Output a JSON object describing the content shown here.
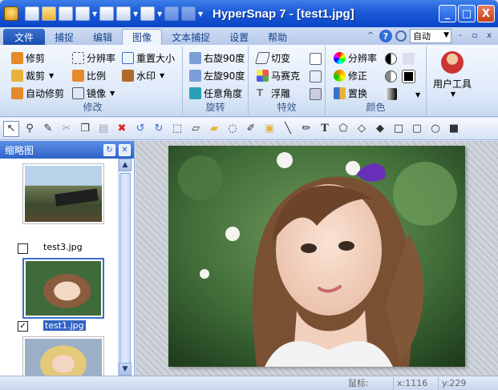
{
  "window": {
    "title": "HyperSnap 7 - [test1.jpg]",
    "controls": [
      "_",
      "□",
      "X"
    ]
  },
  "tabs": {
    "file": "文件",
    "items": [
      "捕捉",
      "编辑",
      "图像",
      "文本捕捉",
      "设置",
      "帮助"
    ],
    "active": "图像",
    "zoom_value": "自动",
    "help_glyph": "?",
    "caret_up": "^",
    "mini_controls": [
      "-",
      "▫",
      "x"
    ]
  },
  "ribbon": {
    "groups": [
      {
        "label": "修改",
        "items": [
          "修剪",
          "分辨率",
          "重置大小",
          "裁剪",
          "比例",
          "水印",
          "自动修剪",
          "镜像"
        ]
      },
      {
        "label": "旋转",
        "items": [
          "右旋90度",
          "左旋90度",
          "任意角度"
        ]
      },
      {
        "label": "特效",
        "items": [
          "切变",
          "马赛克",
          "浮雕"
        ]
      },
      {
        "label": "颜色",
        "items": [
          "分辨率",
          "修正",
          "置换"
        ]
      },
      {
        "label": "",
        "items": [
          "用户工具"
        ]
      }
    ]
  },
  "toolbar2": {
    "icons": [
      "select-arrow-icon",
      "zoom-lens-icon",
      "eyedropper-icon",
      "cut-icon",
      "copy-icon",
      "paste-icon",
      "delete-icon",
      "undo-icon",
      "redo-icon",
      "crop-select-icon",
      "eraser-icon",
      "highlight-icon",
      "lasso-icon",
      "color-picker-icon",
      "stamp-icon",
      "line-icon",
      "pencil-icon",
      "text-icon",
      "polygon-icon",
      "freeform-icon",
      "fill-icon",
      "rectangle-icon",
      "rounded-rect-icon",
      "ellipse-icon",
      "filled-rect-icon"
    ],
    "text_glyph": "T"
  },
  "panel": {
    "title": "缩略图",
    "thumbnails": [
      {
        "name": "test3.jpg",
        "checked": false,
        "selected": false,
        "check_glyph": ""
      },
      {
        "name": "test1.jpg",
        "checked": true,
        "selected": true,
        "check_glyph": "✓"
      },
      {
        "name": "",
        "checked": false,
        "selected": false,
        "check_glyph": ""
      }
    ],
    "scroll_up": "▲",
    "scroll_down": "▼"
  },
  "status": {
    "label": "鼠标:",
    "x": "x:1116",
    "y": "y:229"
  },
  "colors": {
    "title_bar": "#1c5ad6",
    "ribbon_bg": "#dde8f8",
    "selection": "#3163c5"
  }
}
